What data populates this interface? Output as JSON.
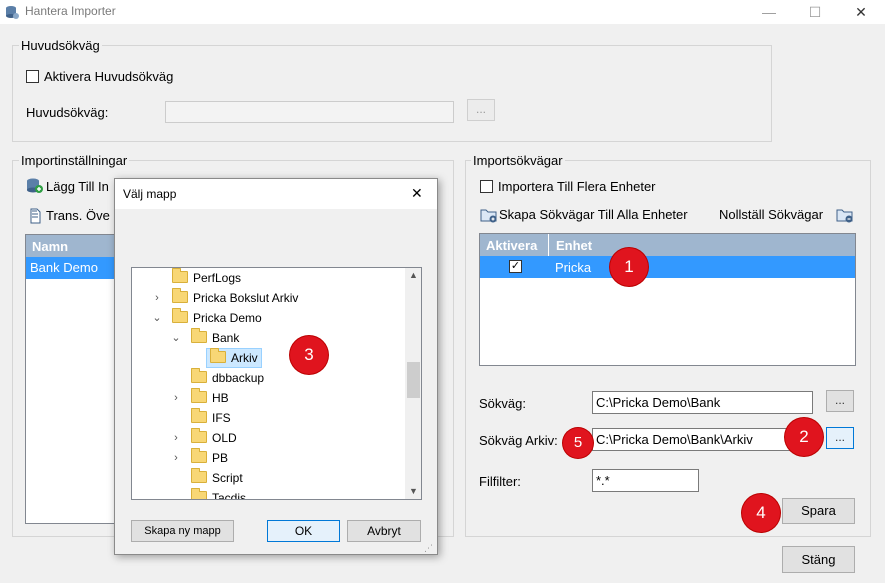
{
  "window": {
    "title": "Hantera Importer",
    "minimize": "—",
    "maximize": "☐",
    "close": "✕"
  },
  "huvud": {
    "group_title": "Huvudsökväg",
    "checkbox_label": "Aktivera Huvudsökväg",
    "path_label": "Huvudsökväg:",
    "path_value": "",
    "browse": "..."
  },
  "import_settings": {
    "group_title": "Importinställningar",
    "add_label": "Lägg Till In",
    "trans_label": "Trans. Öve",
    "column_name": "Namn",
    "rows": [
      "Bank Demo"
    ]
  },
  "import_paths": {
    "group_title": "Importsökvägar",
    "multi_checkbox": "Importera Till Flera Enheter",
    "create_paths": "Skapa Sökvägar Till Alla Enheter",
    "reset_paths": "Nollställ Sökvägar",
    "col_activate": "Aktivera",
    "col_unit": "Enhet",
    "rows": [
      {
        "checked": "✓",
        "unit": "Pricka"
      }
    ],
    "path_label": "Sökväg:",
    "path_value": "C:\\Pricka Demo\\Bank",
    "archive_label": "Sökväg Arkiv:",
    "archive_value": "C:\\Pricka Demo\\Bank\\Arkiv",
    "filter_label": "Filfilter:",
    "filter_value": "*.*",
    "browse": "...",
    "save": "Spara"
  },
  "close_button": "Stäng",
  "dialog": {
    "title": "Välj mapp",
    "close": "✕",
    "tree": [
      {
        "label": "PerfLogs",
        "chevron": ""
      },
      {
        "label": "Pricka Bokslut Arkiv",
        "chevron": "›"
      },
      {
        "label": "Pricka Demo",
        "chevron": "⌄"
      },
      {
        "label": "Bank",
        "chevron": "⌄"
      },
      {
        "label": "Arkiv",
        "chevron": ""
      },
      {
        "label": "dbbackup",
        "chevron": ""
      },
      {
        "label": "HB",
        "chevron": "›"
      },
      {
        "label": "IFS",
        "chevron": ""
      },
      {
        "label": "OLD",
        "chevron": "›"
      },
      {
        "label": "PB",
        "chevron": "›"
      },
      {
        "label": "Script",
        "chevron": ""
      },
      {
        "label": "Tacdis",
        "chevron": ""
      }
    ],
    "new_folder": "Skapa ny mapp",
    "ok": "OK",
    "cancel": "Avbryt"
  },
  "badges": [
    "1",
    "2",
    "3",
    "4",
    "5"
  ],
  "colors": {
    "accent": "#3399ff",
    "badge": "#e0141e",
    "header": "#9fb6cf"
  }
}
